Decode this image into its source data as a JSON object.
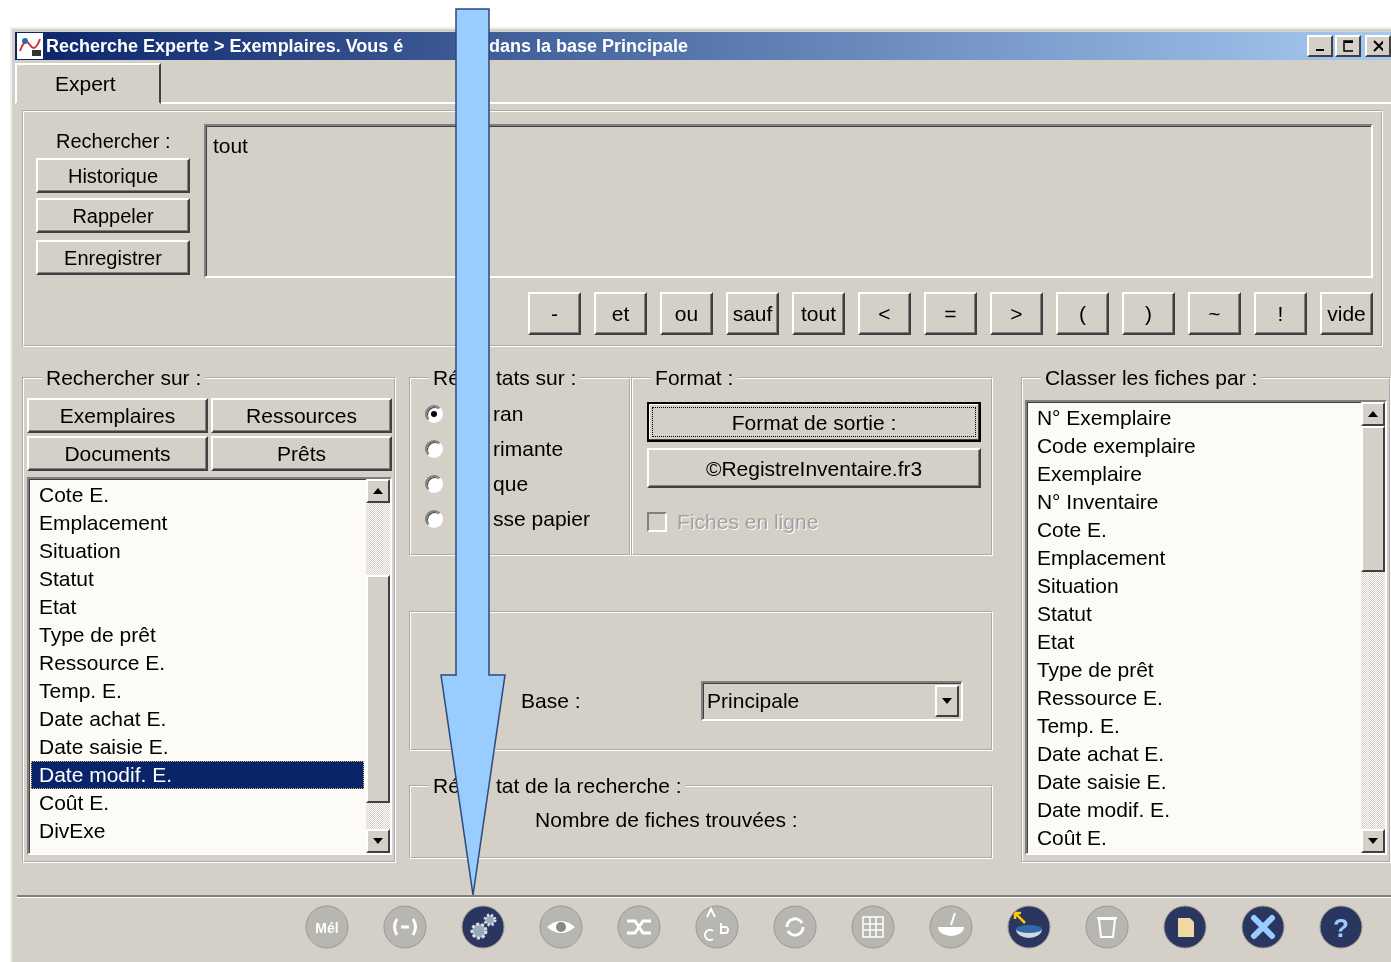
{
  "window": {
    "title_parts": [
      "Recherche Experte > Exemplaires. Vous é",
      "dans la base Principale"
    ]
  },
  "tabs": [
    {
      "label": "Expert",
      "selected": true
    }
  ],
  "search": {
    "label": "Rechercher :",
    "buttons": [
      "Historique",
      "Rappeler",
      "Enregistrer"
    ],
    "value": "tout",
    "operators": [
      "-",
      "et",
      "ou",
      "sauf",
      "tout",
      "<",
      "=",
      ">",
      "(",
      ")",
      "~",
      "!",
      "vide"
    ]
  },
  "search_on": {
    "title": "Rechercher sur :",
    "buttons": [
      "Exemplaires",
      "Ressources",
      "Documents",
      "Prêts"
    ],
    "items": [
      {
        "label": "Cote E.",
        "selected": false
      },
      {
        "label": "Emplacement",
        "selected": false
      },
      {
        "label": "Situation",
        "selected": false
      },
      {
        "label": "Statut",
        "selected": false
      },
      {
        "label": "Etat",
        "selected": false
      },
      {
        "label": "Type de prêt",
        "selected": false
      },
      {
        "label": "Ressource E.",
        "selected": false
      },
      {
        "label": "Temp. E.",
        "selected": false
      },
      {
        "label": "Date achat E.",
        "selected": false
      },
      {
        "label": "Date saisie E.",
        "selected": false
      },
      {
        "label": "Date modif. E.",
        "selected": true
      },
      {
        "label": "Coût E.",
        "selected": false
      },
      {
        "label": "DivExe",
        "selected": false
      }
    ]
  },
  "results_on": {
    "title_parts": [
      "Ré",
      "tats sur :"
    ],
    "options": [
      {
        "label": "ran",
        "selected": true
      },
      {
        "label": "rimante",
        "selected": false
      },
      {
        "label": "que",
        "selected": false
      },
      {
        "label": "sse papier",
        "selected": false
      }
    ]
  },
  "format": {
    "title": "Format :",
    "buttons": [
      {
        "label": "Format de sortie :",
        "focused": true
      },
      {
        "label": "©RegistreInventaire.fr3",
        "focused": false
      }
    ],
    "checkbox": {
      "label": "Fiches en ligne",
      "checked": false,
      "disabled": true
    }
  },
  "base": {
    "label": "Base :",
    "value": "Principale"
  },
  "result": {
    "title_parts": [
      "Ré",
      "tat de la recherche :"
    ],
    "count_label": "Nombre de fiches trouvées :"
  },
  "sort_by": {
    "title": "Classer les fiches par :",
    "items": [
      {
        "label": "N° Exemplaire",
        "selected": false
      },
      {
        "label": "Code exemplaire",
        "selected": false
      },
      {
        "label": "Exemplaire",
        "selected": false
      },
      {
        "label": "N° Inventaire",
        "selected": false
      },
      {
        "label": "Cote E.",
        "selected": false
      },
      {
        "label": "Emplacement",
        "selected": false
      },
      {
        "label": "Situation",
        "selected": false
      },
      {
        "label": "Statut",
        "selected": false
      },
      {
        "label": "Etat",
        "selected": false
      },
      {
        "label": "Type de prêt",
        "selected": false
      },
      {
        "label": "Ressource E.",
        "selected": false
      },
      {
        "label": "Temp. E.",
        "selected": false
      },
      {
        "label": "Date achat E.",
        "selected": false
      },
      {
        "label": "Date saisie E.",
        "selected": false
      },
      {
        "label": "Date modif. E.",
        "selected": false
      },
      {
        "label": "Coût E.",
        "selected": false
      }
    ]
  },
  "toolbar": [
    {
      "kind": "mail",
      "label": "Mél",
      "disabled": true
    },
    {
      "kind": "link",
      "disabled": true
    },
    {
      "kind": "gears",
      "disabled": false
    },
    {
      "kind": "eye",
      "disabled": true
    },
    {
      "kind": "shuffle",
      "disabled": true
    },
    {
      "kind": "letters",
      "disabled": true
    },
    {
      "kind": "refresh",
      "disabled": true
    },
    {
      "kind": "grid",
      "disabled": true
    },
    {
      "kind": "bowl",
      "disabled": true
    },
    {
      "kind": "bowl-arrow",
      "disabled": false
    },
    {
      "kind": "trash",
      "disabled": true
    },
    {
      "kind": "note",
      "disabled": false
    },
    {
      "kind": "close",
      "disabled": false
    },
    {
      "kind": "help",
      "label": "?",
      "disabled": false
    }
  ]
}
